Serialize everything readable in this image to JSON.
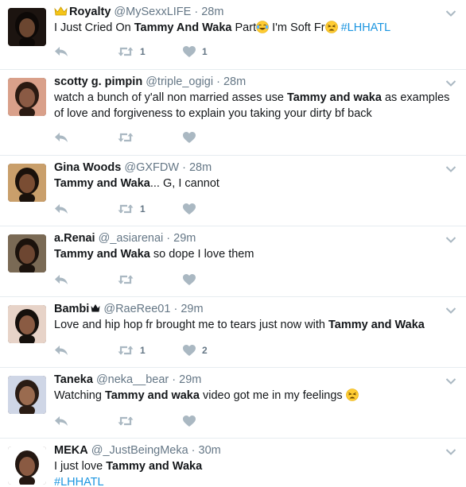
{
  "tweets": [
    {
      "fullname": "Royalty",
      "fullname_prefix_icon": "crown-emoji",
      "username": "@MySexxLIFE",
      "time": "28m",
      "segments": [
        {
          "t": "I Just Cried On "
        },
        {
          "t": "Tammy And Waka",
          "b": true
        },
        {
          "t": " Part"
        },
        {
          "emoji": "tears-of-joy"
        },
        {
          "t": " I'm Soft Fr"
        },
        {
          "emoji": "weary-face"
        },
        {
          "t": " "
        },
        {
          "t": "#LHHATL",
          "hashtag": true
        }
      ],
      "retweets": "1",
      "likes": "1"
    },
    {
      "fullname": "scotty g. pimpin",
      "username": "@triple_ogigi",
      "time": "28m",
      "segments": [
        {
          "t": "watch a bunch of y'all non married asses use "
        },
        {
          "t": "Tammy and waka",
          "b": true
        },
        {
          "t": " as examples of love and forgiveness to explain you taking your dirty bf back"
        }
      ],
      "retweets": "",
      "likes": ""
    },
    {
      "fullname": "Gina Woods",
      "username": "@GXFDW",
      "time": "28m",
      "segments": [
        {
          "t": "Tammy and Waka",
          "b": true
        },
        {
          "t": "... G, I cannot"
        }
      ],
      "retweets": "1",
      "likes": ""
    },
    {
      "fullname": "a.Renai",
      "username": "@_asiarenai",
      "time": "29m",
      "segments": [
        {
          "t": "Tammy and Waka",
          "b": true
        },
        {
          "t": " so dope I love them"
        }
      ],
      "retweets": "",
      "likes": ""
    },
    {
      "fullname": "Bambi",
      "fullname_suffix_icon": "crown-symbol",
      "username": "@RaeRee01",
      "time": "29m",
      "segments": [
        {
          "t": "Love and hip hop fr brought me to tears just now with "
        },
        {
          "t": "Tammy and Waka",
          "b": true
        }
      ],
      "retweets": "1",
      "likes": "2"
    },
    {
      "fullname": "Taneka",
      "username": "@neka__bear",
      "time": "29m",
      "segments": [
        {
          "t": "Watching "
        },
        {
          "t": "Tammy and waka",
          "b": true
        },
        {
          "t": " video got me in my feelings "
        },
        {
          "emoji": "weary-face"
        }
      ],
      "retweets": "",
      "likes": ""
    },
    {
      "fullname": "MEKA",
      "username": "@_JustBeingMeka",
      "time": "30m",
      "segments": [
        {
          "t": "I just love "
        },
        {
          "t": "Tammy and Waka",
          "b": true
        },
        {
          "br": true
        },
        {
          "t": "#LHHATL",
          "hashtag": true
        }
      ],
      "retweets": "",
      "likes": ""
    }
  ],
  "separator": "·",
  "colors": {
    "text": "#14171a",
    "secondary": "#657786",
    "action_icon": "#aab8c2",
    "hashtag": "#1b95e0",
    "divider": "#e6ecf0"
  },
  "icons": {
    "reply": "reply-icon",
    "retweet": "retweet-icon",
    "like": "heart-icon",
    "more": "chevron-down-icon"
  }
}
